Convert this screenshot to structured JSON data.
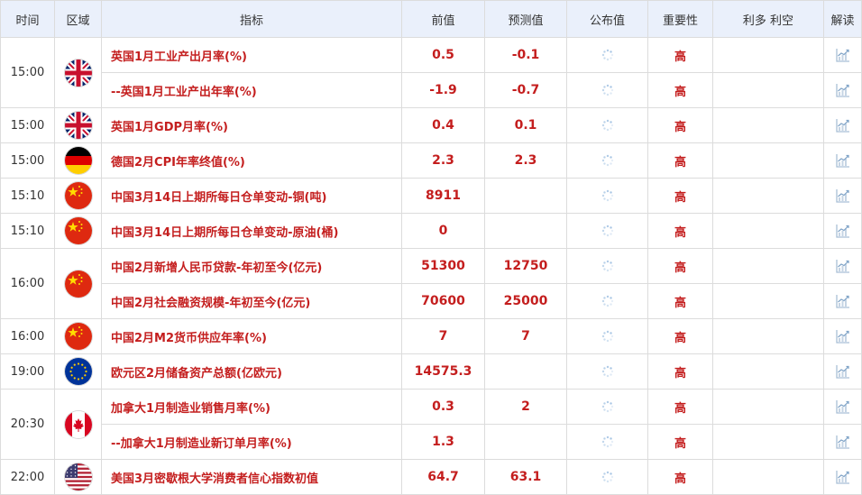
{
  "headers": {
    "time": "时间",
    "region": "区域",
    "indicator": "指标",
    "previous": "前值",
    "forecast": "预测值",
    "actual": "公布值",
    "importance": "重要性",
    "impact": "利多 利空",
    "analysis": "解读"
  },
  "importance_label": "高",
  "colors": {
    "accent_red": "#c41e1e",
    "header_bg": "#eaf0fb",
    "border": "#dcdcdc"
  },
  "groups": [
    {
      "time": "15:00",
      "flag": "gb-flag-icon",
      "rows": [
        {
          "indicator": "英国1月工业产出月率(%)",
          "previous": "0.5",
          "forecast": "-0.1"
        },
        {
          "indicator": "--英国1月工业产出年率(%)",
          "previous": "-1.9",
          "forecast": "-0.7"
        }
      ]
    },
    {
      "time": "15:00",
      "flag": "gb-flag-icon",
      "rows": [
        {
          "indicator": "英国1月GDP月率(%)",
          "previous": "0.4",
          "forecast": "0.1"
        }
      ]
    },
    {
      "time": "15:00",
      "flag": "de-flag-icon",
      "rows": [
        {
          "indicator": "德国2月CPI年率终值(%)",
          "previous": "2.3",
          "forecast": "2.3"
        }
      ]
    },
    {
      "time": "15:10",
      "flag": "cn-flag-icon",
      "rows": [
        {
          "indicator": "中国3月14日上期所每日仓单变动-铜(吨)",
          "previous": "8911",
          "forecast": ""
        }
      ]
    },
    {
      "time": "15:10",
      "flag": "cn-flag-icon",
      "rows": [
        {
          "indicator": "中国3月14日上期所每日仓单变动-原油(桶)",
          "previous": "0",
          "forecast": ""
        }
      ]
    },
    {
      "time": "16:00",
      "flag": "cn-flag-icon",
      "rows": [
        {
          "indicator": "中国2月新增人民币贷款-年初至今(亿元)",
          "previous": "51300",
          "forecast": "12750"
        },
        {
          "indicator": "中国2月社会融资规模-年初至今(亿元)",
          "previous": "70600",
          "forecast": "25000"
        }
      ]
    },
    {
      "time": "16:00",
      "flag": "cn-flag-icon",
      "rows": [
        {
          "indicator": "中国2月M2货币供应年率(%)",
          "previous": "7",
          "forecast": "7"
        }
      ]
    },
    {
      "time": "19:00",
      "flag": "eu-flag-icon",
      "rows": [
        {
          "indicator": "欧元区2月储备资产总额(亿欧元)",
          "previous": "14575.3",
          "forecast": ""
        }
      ]
    },
    {
      "time": "20:30",
      "flag": "ca-flag-icon",
      "rows": [
        {
          "indicator": "加拿大1月制造业销售月率(%)",
          "previous": "0.3",
          "forecast": "2"
        },
        {
          "indicator": "--加拿大1月制造业新订单月率(%)",
          "previous": "1.3",
          "forecast": ""
        }
      ]
    },
    {
      "time": "22:00",
      "flag": "us-flag-icon",
      "rows": [
        {
          "indicator": "美国3月密歇根大学消费者信心指数初值",
          "previous": "64.7",
          "forecast": "63.1"
        }
      ]
    }
  ]
}
